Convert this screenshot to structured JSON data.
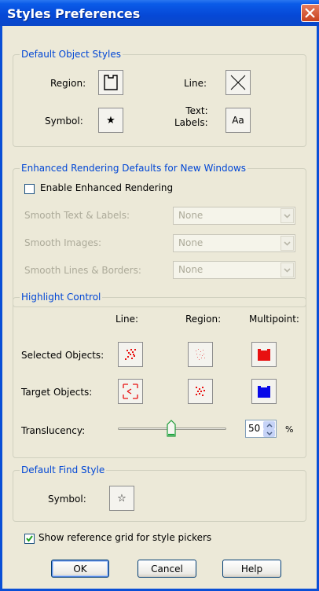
{
  "window": {
    "title": "Styles Preferences"
  },
  "default_object_styles": {
    "legend": "Default Object Styles",
    "region_label": "Region:",
    "line_label": "Line:",
    "symbol_label": "Symbol:",
    "text_labels_label": "Text:\nLabels:",
    "text_labels_button": "Aa",
    "symbol_glyph": "★"
  },
  "enhanced_rendering": {
    "legend": "Enhanced Rendering Defaults for New Windows",
    "enable_label": "Enable Enhanced Rendering",
    "enable_checked": false,
    "smooth_text_label": "Smooth Text & Labels:",
    "smooth_text_value": "None",
    "smooth_images_label": "Smooth Images:",
    "smooth_images_value": "None",
    "smooth_lines_label": "Smooth Lines & Borders:",
    "smooth_lines_value": "None"
  },
  "highlight_control": {
    "legend": "Highlight Control",
    "col_line": "Line:",
    "col_region": "Region:",
    "col_multipoint": "Multipoint:",
    "selected_label": "Selected Objects:",
    "target_label": "Target Objects:",
    "translucency_label": "Translucency:",
    "translucency_value": "50",
    "translucency_unit": "%",
    "translucency_fraction": 0.5,
    "colors": {
      "selected": "#e81010",
      "target": "#0a0af0",
      "selected_multipoint": "#e81010",
      "target_multipoint": "#0808e8"
    }
  },
  "default_find_style": {
    "legend": "Default Find Style",
    "symbol_label": "Symbol:",
    "symbol_glyph": "☆"
  },
  "show_grid": {
    "label": "Show reference grid for style pickers",
    "checked": true
  },
  "buttons": {
    "ok": "OK",
    "cancel": "Cancel",
    "help": "Help"
  }
}
